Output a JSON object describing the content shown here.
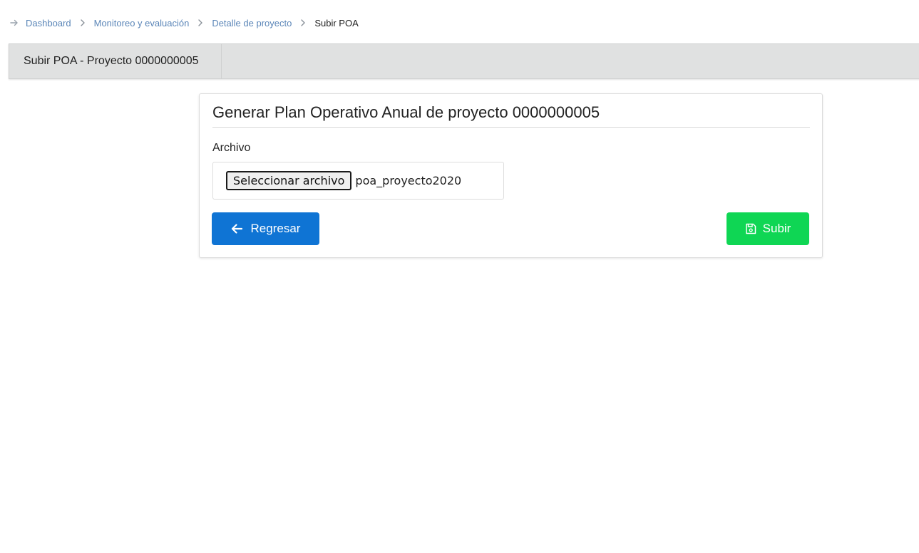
{
  "breadcrumb": {
    "start_icon": "arrow-right-icon",
    "separator_icon": "chevron-right-icon",
    "items": [
      {
        "label": "Dashboard"
      },
      {
        "label": "Monitoreo y evaluación"
      },
      {
        "label": "Detalle de proyecto"
      },
      {
        "label": "Subir POA"
      }
    ]
  },
  "tabs": [
    {
      "label": "Subir POA - Proyecto 0000000005"
    }
  ],
  "card": {
    "title": "Generar Plan Operativo Anual de proyecto 0000000005",
    "file_field": {
      "label": "Archivo",
      "button_label": "Seleccionar archivo",
      "value": "poa_proyecto2020"
    },
    "back_button": {
      "label": "Regresar",
      "icon": "arrow-left-icon",
      "color": "#0f74d4"
    },
    "submit_button": {
      "label": "Subir",
      "icon": "floppy-disk-icon",
      "color": "#0fd654"
    }
  },
  "colors": {
    "link": "#5b86b8",
    "tabbar_bg": "#e0e1e1"
  }
}
